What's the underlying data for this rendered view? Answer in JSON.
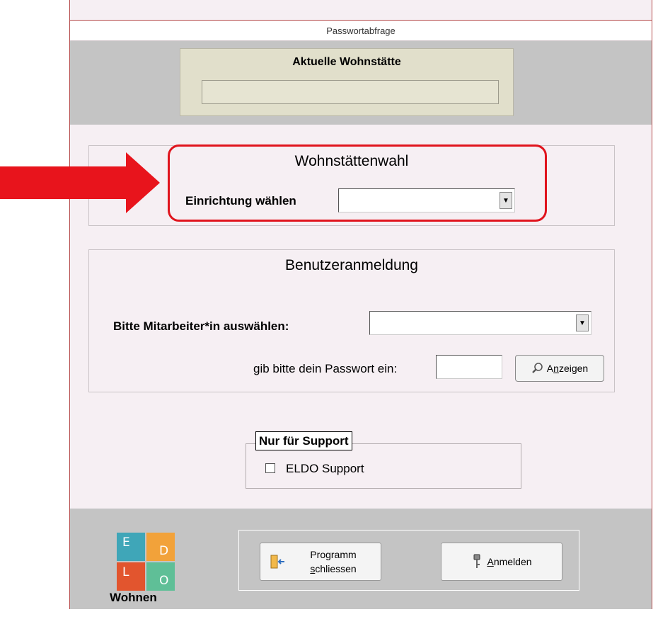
{
  "window": {
    "title": "Passwortabfrage"
  },
  "header": {
    "current_site_label": "Aktuelle Wohnstätte",
    "current_site_value": ""
  },
  "site_selection": {
    "title": "Wohnstättenwahl",
    "label": "Einrichtung wählen",
    "selected": ""
  },
  "user_login": {
    "title": "Benutzeranmeldung",
    "staff_label": "Bitte Mitarbeiter*in auswählen:",
    "staff_selected": "",
    "password_label": "gib bitte dein Passwort ein:",
    "password_value": "",
    "show_button": {
      "prefix": "A",
      "mnemonic": "n",
      "suffix": "zeigen"
    }
  },
  "support": {
    "legend": "Nur für Support",
    "checkbox_label": "ELDO Support",
    "checked": false
  },
  "footer": {
    "logo": {
      "letters": [
        "E",
        "D",
        "L",
        "O"
      ],
      "text": "Wohnen"
    },
    "exit_button": {
      "line1": "Programm",
      "line2_mnemonic": "s",
      "line2_rest": "chliessen"
    },
    "login_button": {
      "mnemonic": "A",
      "rest": "nmelden"
    }
  },
  "colors": {
    "highlight": "#e0141d",
    "logo_e": "#3fa6b8",
    "logo_d": "#f2a23a",
    "logo_l": "#e2552e",
    "logo_o": "#5fbf97"
  }
}
